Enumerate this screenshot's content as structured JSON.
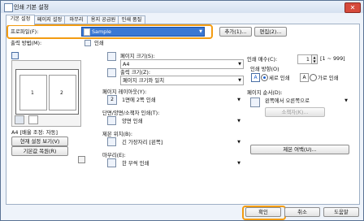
{
  "window": {
    "title": "인쇄 기본 설정",
    "close_label": "✕"
  },
  "tabs": [
    {
      "label": "기본 설정"
    },
    {
      "label": "페이지 설정"
    },
    {
      "label": "마무리"
    },
    {
      "label": "용지 공급원"
    },
    {
      "label": "인쇄 품질"
    }
  ],
  "profile": {
    "label": "프로파일(F):",
    "value": "Sample",
    "add_button": "추가(1)...",
    "edit_button": "편집(2)..."
  },
  "output_method": {
    "label": "출력 방법(M):",
    "value": "인쇄"
  },
  "page_size": {
    "label": "페이지 크기(S):",
    "value": "A4"
  },
  "output_size": {
    "label": "출력 크기(Z):",
    "value": "페이지 크기와 일치"
  },
  "copies": {
    "label": "인쇄 매수(C):",
    "value": "1",
    "range": "[1 ~ 999]"
  },
  "orientation": {
    "label": "인쇄 방향(O)",
    "portrait": "A ● 세로 인쇄",
    "landscape": "A ○ 가로 인쇄",
    "portrait_text": "세로 인쇄",
    "landscape_text": "가로 인쇄"
  },
  "page_layout": {
    "label": "페이지 레이아웃(Y):",
    "value": "1면에 2쪽 인쇄",
    "badge": "2"
  },
  "page_order": {
    "label": "페이지 순서(D):",
    "value": "왼쪽에서 오른쪽으로",
    "detail_button": "소책자(K)..."
  },
  "duplex": {
    "label": "단면/양면/소책자 인쇄(T):",
    "value": "양면 인쇄"
  },
  "binding": {
    "label": "제본 위치(B):",
    "value": "긴 가장자리 [왼쪽]"
  },
  "finishing": {
    "label": "마무리(E):",
    "value": "한 부씩 인쇄"
  },
  "watermark_button": "제본 여백(U)...",
  "preview": {
    "caption": "A4 [배율 조정: 자동]",
    "page_numbers": [
      "1",
      "2"
    ],
    "settings_button": "현재 설정 보기(V)",
    "restore_button": "기본값 복원(R)"
  },
  "footer": {
    "ok": "확인",
    "cancel": "취소",
    "help": "도움말"
  }
}
